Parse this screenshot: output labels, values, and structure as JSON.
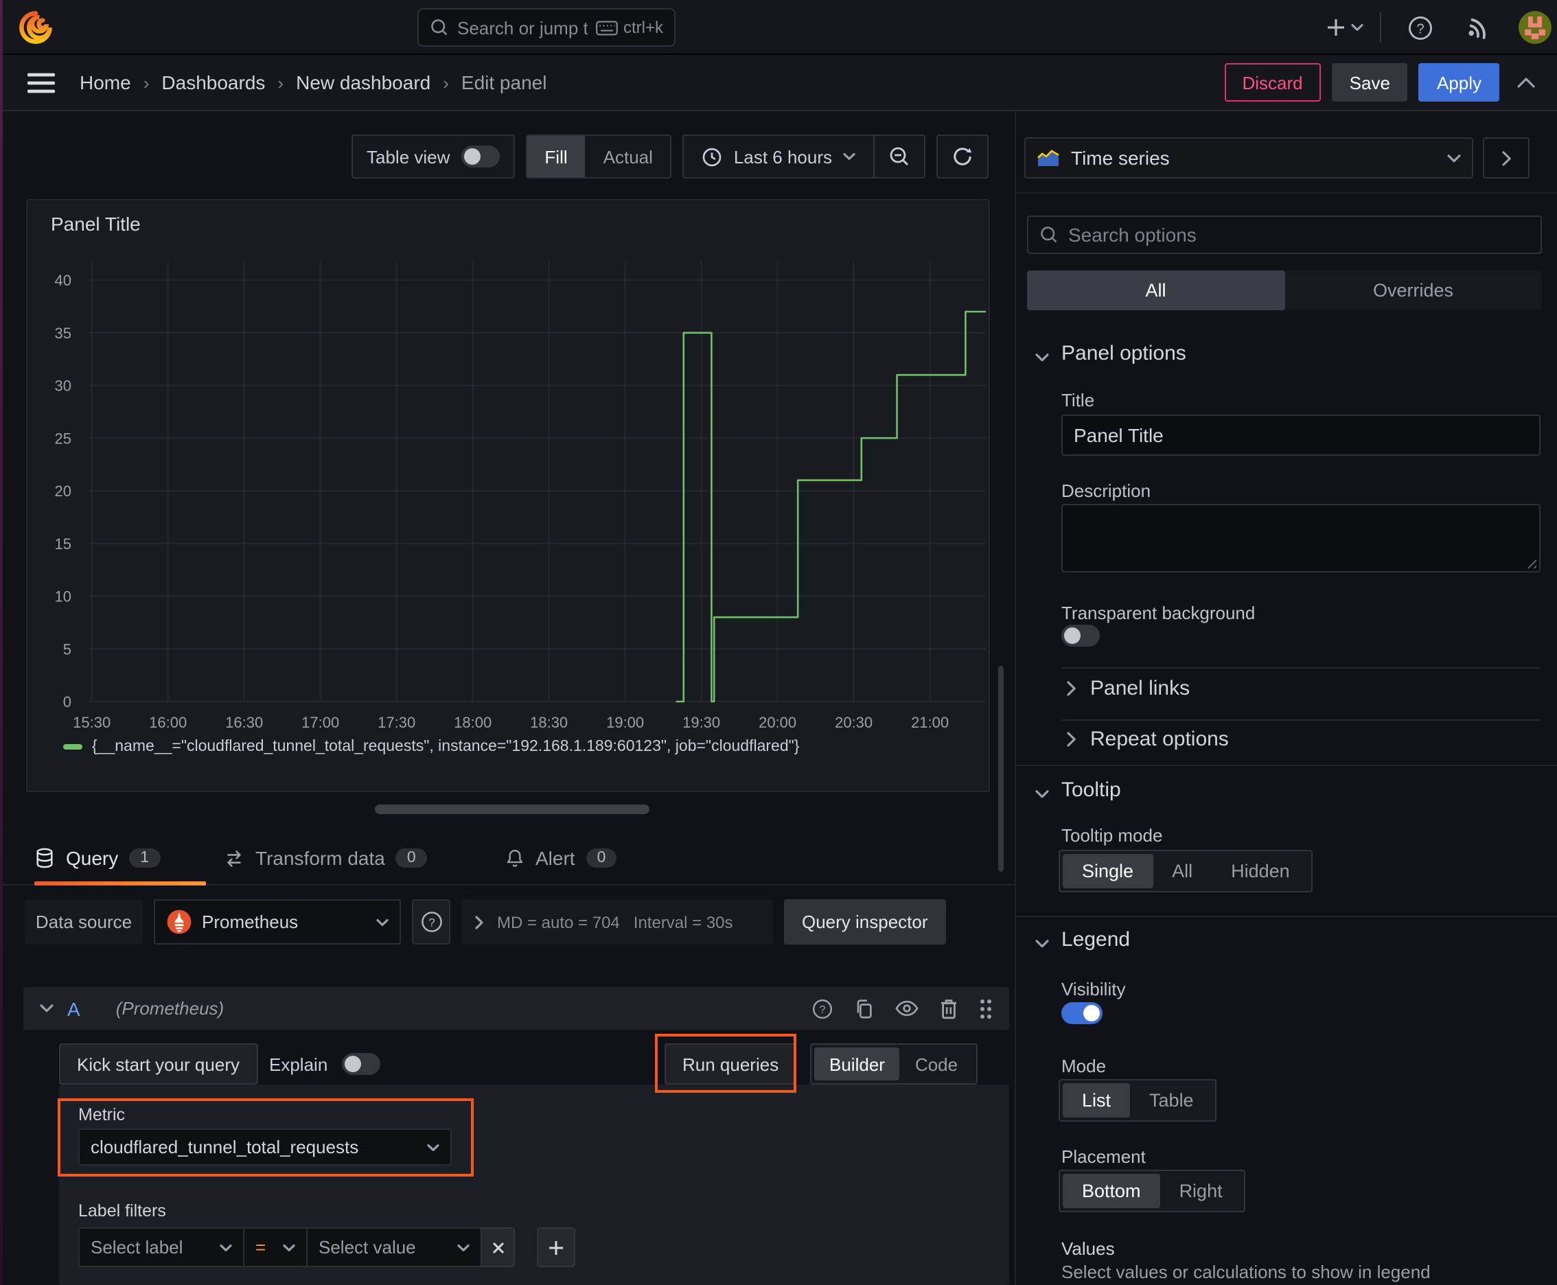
{
  "topbar": {
    "search_placeholder": "Search or jump to...",
    "shortcut": "ctrl+k"
  },
  "breadcrumb": {
    "items": [
      "Home",
      "Dashboards",
      "New dashboard",
      "Edit panel"
    ]
  },
  "header_actions": {
    "discard": "Discard",
    "save": "Save",
    "apply": "Apply"
  },
  "panel_toolbar": {
    "table_view": "Table view",
    "fill": "Fill",
    "actual": "Actual",
    "time_range": "Last 6 hours"
  },
  "panel": {
    "title": "Panel Title"
  },
  "chart_data": {
    "type": "line",
    "render_style": "step",
    "title": "Panel Title",
    "xlabel": "",
    "ylabel": "",
    "ylim": [
      0,
      40
    ],
    "y_ticks": [
      0,
      5,
      10,
      15,
      20,
      25,
      30,
      35,
      40
    ],
    "x_start": "15:28",
    "x_end": "21:21",
    "x_total_minutes": 353,
    "x_ticks": [
      {
        "m": 1,
        "label": "15:30"
      },
      {
        "m": 31,
        "label": "16:00"
      },
      {
        "m": 61,
        "label": "16:30"
      },
      {
        "m": 91,
        "label": "17:00"
      },
      {
        "m": 121,
        "label": "17:30"
      },
      {
        "m": 151,
        "label": "18:00"
      },
      {
        "m": 181,
        "label": "18:30"
      },
      {
        "m": 211,
        "label": "19:00"
      },
      {
        "m": 241,
        "label": "19:30"
      },
      {
        "m": 271,
        "label": "20:00"
      },
      {
        "m": 301,
        "label": "20:30"
      },
      {
        "m": 331,
        "label": "21:00"
      }
    ],
    "grid": true,
    "legend_position": "bottom",
    "series": [
      {
        "name": "{__name__=\"cloudflared_tunnel_total_requests\", instance=\"192.168.1.189:60123\", job=\"cloudflared\"}",
        "color": "#73bf69",
        "points": [
          {
            "time": "19:20",
            "value": 0
          },
          {
            "time": "19:23",
            "value": 35
          },
          {
            "time": "19:34",
            "value": 0
          },
          {
            "time": "19:35",
            "value": 8
          },
          {
            "time": "20:08",
            "value": 21
          },
          {
            "time": "20:33",
            "value": 25
          },
          {
            "time": "20:47",
            "value": 31
          },
          {
            "time": "21:14",
            "value": 37
          }
        ],
        "vertices_minute_value": [
          [
            231,
            0
          ],
          [
            234,
            0
          ],
          [
            234,
            35
          ],
          [
            245,
            35
          ],
          [
            245,
            0
          ],
          [
            246,
            0
          ],
          [
            246,
            8
          ],
          [
            279,
            8
          ],
          [
            279,
            21
          ],
          [
            304,
            21
          ],
          [
            304,
            25
          ],
          [
            318,
            25
          ],
          [
            318,
            31
          ],
          [
            345,
            31
          ],
          [
            345,
            37
          ],
          [
            353,
            37
          ]
        ]
      }
    ]
  },
  "query_tabs": {
    "query": "Query",
    "query_count": "1",
    "transform": "Transform data",
    "transform_count": "0",
    "alert": "Alert",
    "alert_count": "0"
  },
  "datasource_bar": {
    "label": "Data source",
    "value": "Prometheus",
    "md": "MD = auto = 704",
    "interval": "Interval = 30s",
    "inspector": "Query inspector"
  },
  "query_row": {
    "ref": "A",
    "datasource": "(Prometheus)"
  },
  "query_toolbar": {
    "kickstart": "Kick start your query",
    "explain": "Explain",
    "run": "Run queries",
    "builder": "Builder",
    "code": "Code"
  },
  "editor": {
    "metric_label": "Metric",
    "metric_value": "cloudflared_tunnel_total_requests",
    "label_filters": "Label filters",
    "select_label": "Select label",
    "operator": "=",
    "select_value": "Select value"
  },
  "sidebar": {
    "viz": "Time series",
    "search_placeholder": "Search options",
    "tab_all": "All",
    "tab_overrides": "Overrides",
    "panel_options": {
      "heading": "Panel options",
      "title_label": "Title",
      "title_value": "Panel Title",
      "description_label": "Description",
      "transparent_label": "Transparent background",
      "links": "Panel links",
      "repeat": "Repeat options"
    },
    "tooltip": {
      "heading": "Tooltip",
      "mode_label": "Tooltip mode",
      "single": "Single",
      "all": "All",
      "hidden": "Hidden"
    },
    "legend": {
      "heading": "Legend",
      "visibility": "Visibility",
      "mode": "Mode",
      "list": "List",
      "table": "Table",
      "placement": "Placement",
      "bottom": "Bottom",
      "right": "Right",
      "values": "Values",
      "values_hint": "Select values or calculations to show in legend"
    }
  },
  "colors": {
    "series_green": "#73bf69",
    "accent_orange": "#f4581f",
    "apply_blue": "#3d71d9",
    "discard_pink": "#e02f6e",
    "grid": "rgba(204,204,220,0.07)",
    "tick_text": "#9da0a8"
  }
}
